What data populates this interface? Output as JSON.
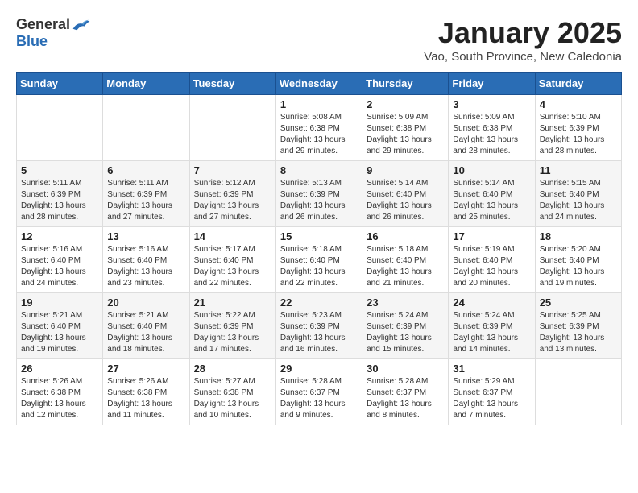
{
  "logo": {
    "general": "General",
    "blue": "Blue"
  },
  "title": "January 2025",
  "subtitle": "Vao, South Province, New Caledonia",
  "weekdays": [
    "Sunday",
    "Monday",
    "Tuesday",
    "Wednesday",
    "Thursday",
    "Friday",
    "Saturday"
  ],
  "weeks": [
    [
      {
        "day": "",
        "info": ""
      },
      {
        "day": "",
        "info": ""
      },
      {
        "day": "",
        "info": ""
      },
      {
        "day": "1",
        "info": "Sunrise: 5:08 AM\nSunset: 6:38 PM\nDaylight: 13 hours and 29 minutes."
      },
      {
        "day": "2",
        "info": "Sunrise: 5:09 AM\nSunset: 6:38 PM\nDaylight: 13 hours and 29 minutes."
      },
      {
        "day": "3",
        "info": "Sunrise: 5:09 AM\nSunset: 6:38 PM\nDaylight: 13 hours and 28 minutes."
      },
      {
        "day": "4",
        "info": "Sunrise: 5:10 AM\nSunset: 6:39 PM\nDaylight: 13 hours and 28 minutes."
      }
    ],
    [
      {
        "day": "5",
        "info": "Sunrise: 5:11 AM\nSunset: 6:39 PM\nDaylight: 13 hours and 28 minutes."
      },
      {
        "day": "6",
        "info": "Sunrise: 5:11 AM\nSunset: 6:39 PM\nDaylight: 13 hours and 27 minutes."
      },
      {
        "day": "7",
        "info": "Sunrise: 5:12 AM\nSunset: 6:39 PM\nDaylight: 13 hours and 27 minutes."
      },
      {
        "day": "8",
        "info": "Sunrise: 5:13 AM\nSunset: 6:39 PM\nDaylight: 13 hours and 26 minutes."
      },
      {
        "day": "9",
        "info": "Sunrise: 5:14 AM\nSunset: 6:40 PM\nDaylight: 13 hours and 26 minutes."
      },
      {
        "day": "10",
        "info": "Sunrise: 5:14 AM\nSunset: 6:40 PM\nDaylight: 13 hours and 25 minutes."
      },
      {
        "day": "11",
        "info": "Sunrise: 5:15 AM\nSunset: 6:40 PM\nDaylight: 13 hours and 24 minutes."
      }
    ],
    [
      {
        "day": "12",
        "info": "Sunrise: 5:16 AM\nSunset: 6:40 PM\nDaylight: 13 hours and 24 minutes."
      },
      {
        "day": "13",
        "info": "Sunrise: 5:16 AM\nSunset: 6:40 PM\nDaylight: 13 hours and 23 minutes."
      },
      {
        "day": "14",
        "info": "Sunrise: 5:17 AM\nSunset: 6:40 PM\nDaylight: 13 hours and 22 minutes."
      },
      {
        "day": "15",
        "info": "Sunrise: 5:18 AM\nSunset: 6:40 PM\nDaylight: 13 hours and 22 minutes."
      },
      {
        "day": "16",
        "info": "Sunrise: 5:18 AM\nSunset: 6:40 PM\nDaylight: 13 hours and 21 minutes."
      },
      {
        "day": "17",
        "info": "Sunrise: 5:19 AM\nSunset: 6:40 PM\nDaylight: 13 hours and 20 minutes."
      },
      {
        "day": "18",
        "info": "Sunrise: 5:20 AM\nSunset: 6:40 PM\nDaylight: 13 hours and 19 minutes."
      }
    ],
    [
      {
        "day": "19",
        "info": "Sunrise: 5:21 AM\nSunset: 6:40 PM\nDaylight: 13 hours and 19 minutes."
      },
      {
        "day": "20",
        "info": "Sunrise: 5:21 AM\nSunset: 6:40 PM\nDaylight: 13 hours and 18 minutes."
      },
      {
        "day": "21",
        "info": "Sunrise: 5:22 AM\nSunset: 6:39 PM\nDaylight: 13 hours and 17 minutes."
      },
      {
        "day": "22",
        "info": "Sunrise: 5:23 AM\nSunset: 6:39 PM\nDaylight: 13 hours and 16 minutes."
      },
      {
        "day": "23",
        "info": "Sunrise: 5:24 AM\nSunset: 6:39 PM\nDaylight: 13 hours and 15 minutes."
      },
      {
        "day": "24",
        "info": "Sunrise: 5:24 AM\nSunset: 6:39 PM\nDaylight: 13 hours and 14 minutes."
      },
      {
        "day": "25",
        "info": "Sunrise: 5:25 AM\nSunset: 6:39 PM\nDaylight: 13 hours and 13 minutes."
      }
    ],
    [
      {
        "day": "26",
        "info": "Sunrise: 5:26 AM\nSunset: 6:38 PM\nDaylight: 13 hours and 12 minutes."
      },
      {
        "day": "27",
        "info": "Sunrise: 5:26 AM\nSunset: 6:38 PM\nDaylight: 13 hours and 11 minutes."
      },
      {
        "day": "28",
        "info": "Sunrise: 5:27 AM\nSunset: 6:38 PM\nDaylight: 13 hours and 10 minutes."
      },
      {
        "day": "29",
        "info": "Sunrise: 5:28 AM\nSunset: 6:37 PM\nDaylight: 13 hours and 9 minutes."
      },
      {
        "day": "30",
        "info": "Sunrise: 5:28 AM\nSunset: 6:37 PM\nDaylight: 13 hours and 8 minutes."
      },
      {
        "day": "31",
        "info": "Sunrise: 5:29 AM\nSunset: 6:37 PM\nDaylight: 13 hours and 7 minutes."
      },
      {
        "day": "",
        "info": ""
      }
    ]
  ]
}
